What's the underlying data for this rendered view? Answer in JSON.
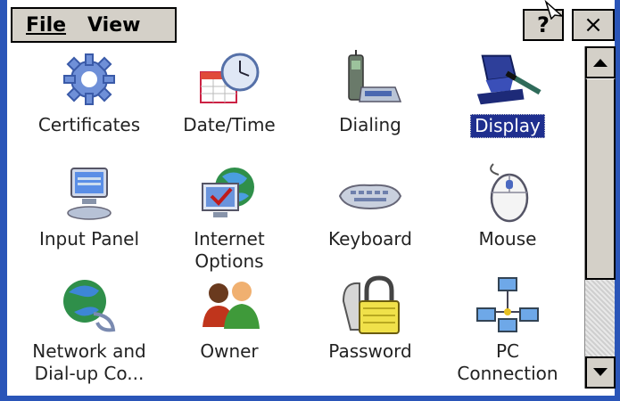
{
  "menu": {
    "file_label": "File",
    "view_label": "View"
  },
  "titlebar": {
    "help_label": "?",
    "close_label": "×"
  },
  "items": [
    {
      "label": "Certificates",
      "icon": "gear-icon",
      "selected": false
    },
    {
      "label": "Date/Time",
      "icon": "calendar-clock-icon",
      "selected": false
    },
    {
      "label": "Dialing",
      "icon": "phone-icon",
      "selected": false
    },
    {
      "label": "Display",
      "icon": "display-icon",
      "selected": true
    },
    {
      "label": "Input Panel",
      "icon": "keyboard-monitor-icon",
      "selected": false
    },
    {
      "label": "Internet\nOptions",
      "icon": "globe-check-icon",
      "selected": false
    },
    {
      "label": "Keyboard",
      "icon": "keyboard-icon",
      "selected": false
    },
    {
      "label": "Mouse",
      "icon": "mouse-icon",
      "selected": false
    },
    {
      "label": "Network and\nDial-up Co...",
      "icon": "network-globe-icon",
      "selected": false
    },
    {
      "label": "Owner",
      "icon": "people-icon",
      "selected": false
    },
    {
      "label": "Password",
      "icon": "padlock-icon",
      "selected": false
    },
    {
      "label": "PC\nConnection",
      "icon": "pc-connection-icon",
      "selected": false
    }
  ],
  "colors": {
    "frame": "#2a55b8",
    "selection": "#1f2f8f",
    "chrome": "#d4d0c8"
  }
}
